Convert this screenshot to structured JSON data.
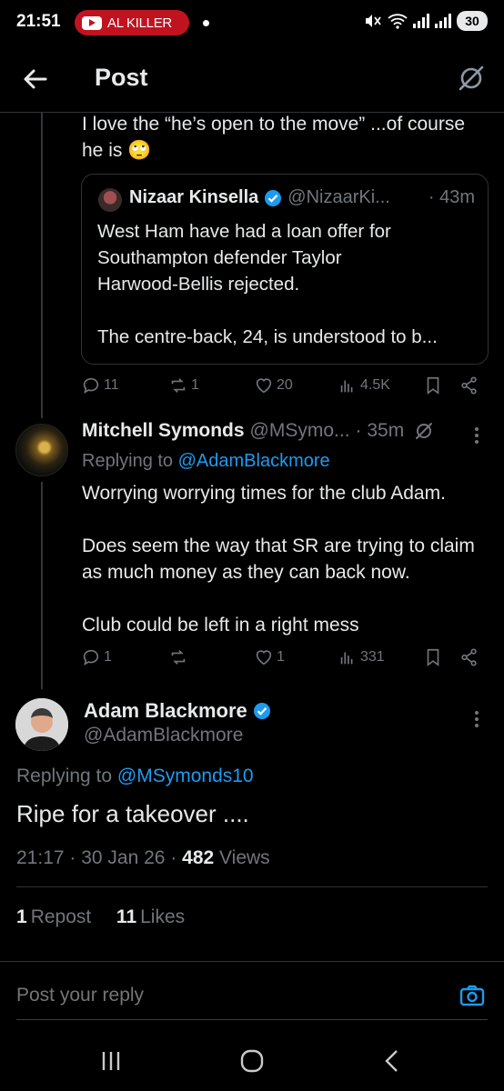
{
  "status_bar": {
    "time": "21:51",
    "notification_label": "AL KILLER",
    "battery": "30",
    "icons": [
      "youtube-icon",
      "mute-icon",
      "wifi-icon",
      "signal-icon",
      "battery-icon"
    ]
  },
  "header": {
    "title": "Post",
    "icons": [
      "back-arrow-icon",
      "grok-icon"
    ]
  },
  "quoted_parent": {
    "text_line1": "I love the “he’s open to the move” ...of course",
    "text_line2": "he is",
    "emoji": "🙄",
    "quote": {
      "name": "Nizaar Kinsella",
      "handle": "@NizaarKi...",
      "time": "· 43m",
      "body": "West Ham have had a loan offer for\nSouthampton defender Taylor\nHarwood-Bellis rejected.\n\nThe centre-back, 24, is understood to b..."
    },
    "actions": {
      "replies": "11",
      "reposts": "1",
      "likes": "20",
      "views": "4.5K"
    }
  },
  "reply": {
    "name": "Mitchell Symonds",
    "handle": "@MSymo...",
    "time": "· 35m",
    "replying_prefix": "Replying to",
    "replying_to": "@AdamBlackmore",
    "paragraphs": [
      "Worrying worrying times for the club Adam.",
      "Does seem the way that SR are trying to claim as much money as they can back now.",
      "Club could be left in a right mess"
    ],
    "actions": {
      "replies": "1",
      "reposts": "",
      "likes": "1",
      "views": "331"
    }
  },
  "main_post": {
    "name": "Adam Blackmore",
    "handle": "@AdamBlackmore",
    "replying_prefix": "Replying to",
    "replying_to": "@MSymonds10",
    "text": "Ripe for a takeover ....",
    "time": "21:17",
    "date": "30 Jan 26",
    "views_count": "482",
    "views_label": "Views",
    "reposts_count": "1",
    "reposts_label": "Repost",
    "likes_count": "11",
    "likes_label": "Likes"
  },
  "composer": {
    "placeholder": "Post your reply"
  },
  "colors": {
    "accent": "#1d9bf0",
    "muted": "#71767b",
    "text": "#e7e9ea",
    "background": "#000000"
  }
}
